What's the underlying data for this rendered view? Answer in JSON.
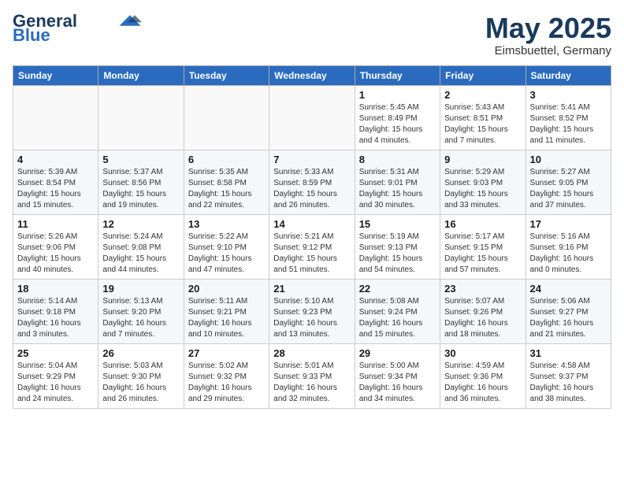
{
  "header": {
    "logo_line1": "General",
    "logo_line2": "Blue",
    "month_year": "May 2025",
    "location": "Eimsbuettel, Germany"
  },
  "weekdays": [
    "Sunday",
    "Monday",
    "Tuesday",
    "Wednesday",
    "Thursday",
    "Friday",
    "Saturday"
  ],
  "weeks": [
    [
      {
        "day": "",
        "info": ""
      },
      {
        "day": "",
        "info": ""
      },
      {
        "day": "",
        "info": ""
      },
      {
        "day": "",
        "info": ""
      },
      {
        "day": "1",
        "info": "Sunrise: 5:45 AM\nSunset: 8:49 PM\nDaylight: 15 hours\nand 4 minutes."
      },
      {
        "day": "2",
        "info": "Sunrise: 5:43 AM\nSunset: 8:51 PM\nDaylight: 15 hours\nand 7 minutes."
      },
      {
        "day": "3",
        "info": "Sunrise: 5:41 AM\nSunset: 8:52 PM\nDaylight: 15 hours\nand 11 minutes."
      }
    ],
    [
      {
        "day": "4",
        "info": "Sunrise: 5:39 AM\nSunset: 8:54 PM\nDaylight: 15 hours\nand 15 minutes."
      },
      {
        "day": "5",
        "info": "Sunrise: 5:37 AM\nSunset: 8:56 PM\nDaylight: 15 hours\nand 19 minutes."
      },
      {
        "day": "6",
        "info": "Sunrise: 5:35 AM\nSunset: 8:58 PM\nDaylight: 15 hours\nand 22 minutes."
      },
      {
        "day": "7",
        "info": "Sunrise: 5:33 AM\nSunset: 8:59 PM\nDaylight: 15 hours\nand 26 minutes."
      },
      {
        "day": "8",
        "info": "Sunrise: 5:31 AM\nSunset: 9:01 PM\nDaylight: 15 hours\nand 30 minutes."
      },
      {
        "day": "9",
        "info": "Sunrise: 5:29 AM\nSunset: 9:03 PM\nDaylight: 15 hours\nand 33 minutes."
      },
      {
        "day": "10",
        "info": "Sunrise: 5:27 AM\nSunset: 9:05 PM\nDaylight: 15 hours\nand 37 minutes."
      }
    ],
    [
      {
        "day": "11",
        "info": "Sunrise: 5:26 AM\nSunset: 9:06 PM\nDaylight: 15 hours\nand 40 minutes."
      },
      {
        "day": "12",
        "info": "Sunrise: 5:24 AM\nSunset: 9:08 PM\nDaylight: 15 hours\nand 44 minutes."
      },
      {
        "day": "13",
        "info": "Sunrise: 5:22 AM\nSunset: 9:10 PM\nDaylight: 15 hours\nand 47 minutes."
      },
      {
        "day": "14",
        "info": "Sunrise: 5:21 AM\nSunset: 9:12 PM\nDaylight: 15 hours\nand 51 minutes."
      },
      {
        "day": "15",
        "info": "Sunrise: 5:19 AM\nSunset: 9:13 PM\nDaylight: 15 hours\nand 54 minutes."
      },
      {
        "day": "16",
        "info": "Sunrise: 5:17 AM\nSunset: 9:15 PM\nDaylight: 15 hours\nand 57 minutes."
      },
      {
        "day": "17",
        "info": "Sunrise: 5:16 AM\nSunset: 9:16 PM\nDaylight: 16 hours\nand 0 minutes."
      }
    ],
    [
      {
        "day": "18",
        "info": "Sunrise: 5:14 AM\nSunset: 9:18 PM\nDaylight: 16 hours\nand 3 minutes."
      },
      {
        "day": "19",
        "info": "Sunrise: 5:13 AM\nSunset: 9:20 PM\nDaylight: 16 hours\nand 7 minutes."
      },
      {
        "day": "20",
        "info": "Sunrise: 5:11 AM\nSunset: 9:21 PM\nDaylight: 16 hours\nand 10 minutes."
      },
      {
        "day": "21",
        "info": "Sunrise: 5:10 AM\nSunset: 9:23 PM\nDaylight: 16 hours\nand 13 minutes."
      },
      {
        "day": "22",
        "info": "Sunrise: 5:08 AM\nSunset: 9:24 PM\nDaylight: 16 hours\nand 15 minutes."
      },
      {
        "day": "23",
        "info": "Sunrise: 5:07 AM\nSunset: 9:26 PM\nDaylight: 16 hours\nand 18 minutes."
      },
      {
        "day": "24",
        "info": "Sunrise: 5:06 AM\nSunset: 9:27 PM\nDaylight: 16 hours\nand 21 minutes."
      }
    ],
    [
      {
        "day": "25",
        "info": "Sunrise: 5:04 AM\nSunset: 9:29 PM\nDaylight: 16 hours\nand 24 minutes."
      },
      {
        "day": "26",
        "info": "Sunrise: 5:03 AM\nSunset: 9:30 PM\nDaylight: 16 hours\nand 26 minutes."
      },
      {
        "day": "27",
        "info": "Sunrise: 5:02 AM\nSunset: 9:32 PM\nDaylight: 16 hours\nand 29 minutes."
      },
      {
        "day": "28",
        "info": "Sunrise: 5:01 AM\nSunset: 9:33 PM\nDaylight: 16 hours\nand 32 minutes."
      },
      {
        "day": "29",
        "info": "Sunrise: 5:00 AM\nSunset: 9:34 PM\nDaylight: 16 hours\nand 34 minutes."
      },
      {
        "day": "30",
        "info": "Sunrise: 4:59 AM\nSunset: 9:36 PM\nDaylight: 16 hours\nand 36 minutes."
      },
      {
        "day": "31",
        "info": "Sunrise: 4:58 AM\nSunset: 9:37 PM\nDaylight: 16 hours\nand 38 minutes."
      }
    ]
  ]
}
